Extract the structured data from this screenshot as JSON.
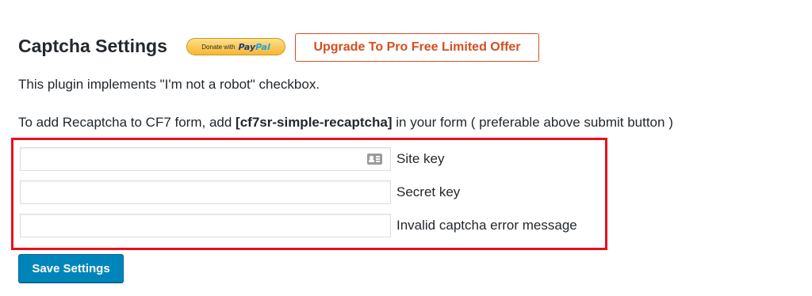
{
  "page": {
    "title": "Captcha Settings"
  },
  "donate": {
    "prefix": "Donate with",
    "brand_pay": "Pay",
    "brand_pal": "Pal"
  },
  "upgrade_button": {
    "label": "Upgrade To Pro Free Limited Offer"
  },
  "description": {
    "line1": "This plugin implements \"I'm not a robot\" checkbox.",
    "line2_prefix": "To add Recaptcha to CF7 form, add ",
    "line2_shortcode": "[cf7sr-simple-recaptcha]",
    "line2_suffix": " in your form ( preferable above submit button )"
  },
  "fields": [
    {
      "label": "Site key",
      "value": ""
    },
    {
      "label": "Secret key",
      "value": ""
    },
    {
      "label": "Invalid captcha error message",
      "value": ""
    }
  ],
  "save_button": {
    "label": "Save Settings"
  },
  "colors": {
    "primary_button": "#0085ba",
    "upgrade_accent": "#d54e21",
    "highlight_box": "#e8101c",
    "paypal_gold": "#f7b733",
    "paypal_navy": "#1a3d82",
    "paypal_blue": "#1fa2e6"
  },
  "icons": {
    "site_key_field": "contact-card-icon"
  }
}
